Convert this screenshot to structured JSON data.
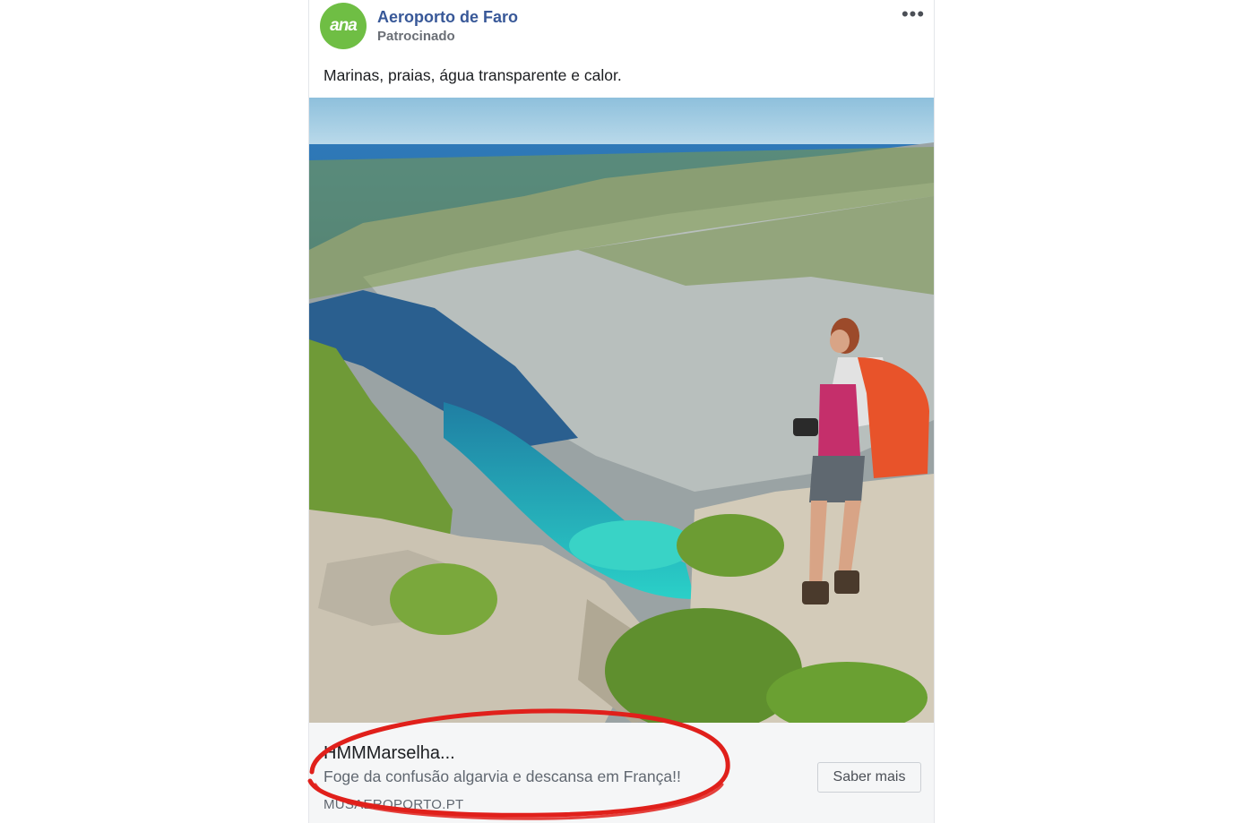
{
  "post": {
    "page_name": "Aeroporto de Faro",
    "sponsored_label": "Patrocinado",
    "avatar_text": "ana",
    "avatar_color": "#6fbe44",
    "more_label": "•••",
    "caption": "Marinas, praias, água transparente e calor."
  },
  "link_preview": {
    "headline": "HMMMarselha...",
    "description": "Foge da confusão algarvia e descansa em França!!",
    "domain": "MUSAEROPORTO.PT",
    "cta_label": "Saber mais"
  },
  "annotation": {
    "shape": "ellipse",
    "color": "#e0201b"
  }
}
